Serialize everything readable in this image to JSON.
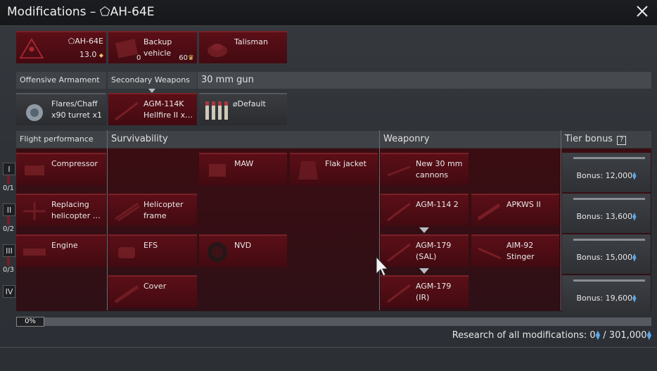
{
  "window": {
    "title_prefix": "Modifications – ",
    "vehicle_glyph": "⬠",
    "vehicle_name": "AH-64E"
  },
  "top_row": {
    "vehicle": {
      "glyph": "⬠",
      "name": "AH-64E",
      "br": "13.0",
      "br_icon": "◆"
    },
    "backup": {
      "label": "Backup\nvehicle",
      "count": "0",
      "price": "60",
      "price_icon": "♛"
    },
    "talisman": {
      "label": "Talisman"
    }
  },
  "weapon_headers": {
    "offensive": "Offensive Armament",
    "secondary": "Secondary Weapons",
    "gun": "30 mm gun"
  },
  "weapon_row": {
    "flares": "Flares/Chaff\nx90 turret x1",
    "hellfire": "AGM-114K\nHellfire II x…",
    "default_glyph": "⌀",
    "default": "Default"
  },
  "sections": {
    "flight": "Flight performance",
    "survivability": "Survivability",
    "weaponry": "Weaponry",
    "tier_bonus": "Tier bonus",
    "tier_bonus_help": "?"
  },
  "tiers": [
    {
      "numeral": "I",
      "count": "0/1"
    },
    {
      "numeral": "II",
      "count": "0/2"
    },
    {
      "numeral": "III",
      "count": "0/3"
    },
    {
      "numeral": "IV"
    }
  ],
  "mods": {
    "compressor": "Compressor",
    "replacing_rotor": "Replacing\nhelicopter …",
    "engine": "Engine",
    "maw": "MAW",
    "flak_jacket": "Flak jacket",
    "heli_frame": "Helicopter\nframe",
    "efs": "EFS",
    "nvd": "NVD",
    "cover": "Cover",
    "new_cannons": "New 30 mm\ncannons",
    "agm114": "AGM-114 2",
    "apkws": "APKWS II",
    "agm179_sal": "AGM-179\n(SAL)",
    "aim92": "AIM-92\nStinger",
    "agm179_ir": "AGM-179 (IR)"
  },
  "bonuses": [
    {
      "label": "Bonus: 12,000"
    },
    {
      "label": "Bonus: 13,600"
    },
    {
      "label": "Bonus: 15,000"
    },
    {
      "label": "Bonus: 19,600"
    }
  ],
  "rp_icon": "⧫",
  "progress": {
    "value": 0,
    "label": "0%"
  },
  "research": {
    "label": "Research of all modifications: ",
    "current": "0",
    "separator": " / ",
    "total": "301,000"
  },
  "colors": {
    "mod_red": "#5b0f17",
    "rp_blue": "#5aa6e8",
    "header_grey": "#3f4246"
  }
}
